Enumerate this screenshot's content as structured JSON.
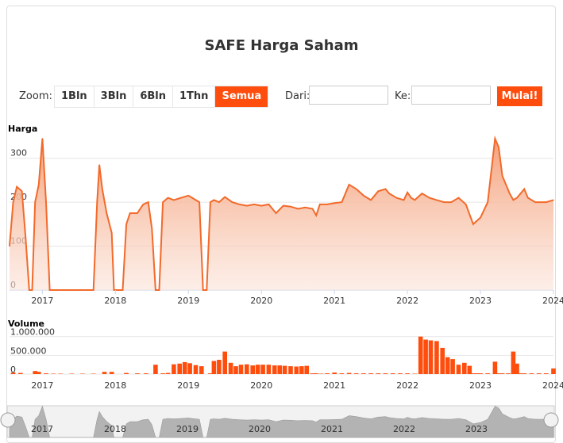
{
  "title": "SAFE Harga Saham",
  "zoom": {
    "label": "Zoom:",
    "buttons": [
      "1Bln",
      "3Bln",
      "6Bln",
      "1Thn",
      "Semua"
    ],
    "active": "Semua"
  },
  "range": {
    "from_label": "Dari:",
    "from_value": "",
    "to_label": "Ke:",
    "to_value": "",
    "submit_label": "Mulai!"
  },
  "colors": {
    "accent": "#ff4d0d",
    "line": "#f26a2b",
    "area_top": "#f5a07a",
    "volume": "#ff4d0d",
    "grid": "#e6e6e6"
  },
  "chart_data": [
    {
      "type": "area",
      "ylabel": "Harga",
      "ylim": [
        0,
        350
      ],
      "yticks": [
        0,
        100,
        200,
        300
      ],
      "xticks": [
        "2017",
        "2018",
        "2019",
        "2020",
        "2021",
        "2022",
        "2023",
        "2024"
      ],
      "x": [
        2016.55,
        2016.6,
        2016.65,
        2016.72,
        2016.77,
        2016.82,
        2016.86,
        2016.9,
        2016.95,
        2017.0,
        2017.05,
        2017.1,
        2017.14,
        2017.3,
        2017.6,
        2017.7,
        2017.75,
        2017.78,
        2017.82,
        2017.88,
        2017.95,
        2017.98,
        2018.02,
        2018.1,
        2018.15,
        2018.2,
        2018.3,
        2018.38,
        2018.45,
        2018.5,
        2018.55,
        2018.6,
        2018.65,
        2018.72,
        2018.8,
        2018.9,
        2019.0,
        2019.05,
        2019.15,
        2019.2,
        2019.25,
        2019.3,
        2019.35,
        2019.42,
        2019.5,
        2019.6,
        2019.7,
        2019.8,
        2019.9,
        2020.0,
        2020.1,
        2020.2,
        2020.3,
        2020.4,
        2020.5,
        2020.6,
        2020.7,
        2020.75,
        2020.8,
        2020.9,
        2021.0,
        2021.1,
        2021.2,
        2021.25,
        2021.3,
        2021.4,
        2021.5,
        2021.6,
        2021.7,
        2021.75,
        2021.85,
        2021.95,
        2022.0,
        2022.05,
        2022.1,
        2022.2,
        2022.3,
        2022.4,
        2022.5,
        2022.55,
        2022.6,
        2022.7,
        2022.8,
        2022.9,
        2023.0,
        2023.1,
        2023.2,
        2023.25,
        2023.3,
        2023.35,
        2023.4,
        2023.45,
        2023.5,
        2023.55,
        2023.6,
        2023.65,
        2023.7,
        2023.75,
        2023.8,
        2023.85,
        2023.9,
        2024.0
      ],
      "values": [
        100,
        200,
        235,
        225,
        120,
        0,
        0,
        200,
        240,
        345,
        200,
        0,
        0,
        0,
        0,
        0,
        200,
        285,
        230,
        175,
        130,
        0,
        0,
        0,
        150,
        175,
        175,
        195,
        200,
        140,
        0,
        0,
        200,
        210,
        205,
        210,
        215,
        210,
        200,
        0,
        0,
        200,
        205,
        200,
        212,
        200,
        195,
        192,
        195,
        192,
        195,
        175,
        192,
        190,
        185,
        188,
        185,
        170,
        195,
        195,
        198,
        200,
        240,
        235,
        230,
        215,
        205,
        225,
        230,
        220,
        210,
        205,
        222,
        210,
        205,
        220,
        210,
        205,
        200,
        200,
        200,
        210,
        195,
        150,
        165,
        200,
        345,
        325,
        260,
        240,
        220,
        205,
        210,
        220,
        230,
        210,
        205,
        200,
        200,
        200,
        200,
        205
      ]
    },
    {
      "type": "bar",
      "ylabel": "Volume",
      "ylim": [
        0,
        1100000
      ],
      "yticks": [
        "0",
        "500.000",
        "1.000.000"
      ],
      "xticks": [
        "2017",
        "2018",
        "2019",
        "2020",
        "2021",
        "2022",
        "2023",
        "2024"
      ],
      "x": [
        2016.6,
        2016.7,
        2016.9,
        2016.95,
        2017.05,
        2017.15,
        2017.25,
        2017.4,
        2017.55,
        2017.7,
        2017.85,
        2017.95,
        2018.15,
        2018.3,
        2018.42,
        2018.55,
        2018.65,
        2018.72,
        2018.8,
        2018.88,
        2018.95,
        2019.02,
        2019.1,
        2019.18,
        2019.3,
        2019.35,
        2019.42,
        2019.5,
        2019.58,
        2019.65,
        2019.72,
        2019.8,
        2019.88,
        2019.95,
        2020.02,
        2020.1,
        2020.18,
        2020.25,
        2020.32,
        2020.4,
        2020.48,
        2020.55,
        2020.62,
        2020.7,
        2020.75,
        2020.82,
        2020.9,
        2021.0,
        2021.1,
        2021.2,
        2021.3,
        2021.4,
        2021.5,
        2021.6,
        2021.7,
        2021.8,
        2021.9,
        2022.0,
        2022.1,
        2022.18,
        2022.25,
        2022.32,
        2022.4,
        2022.48,
        2022.55,
        2022.62,
        2022.7,
        2022.78,
        2022.85,
        2022.9,
        2022.95,
        2023.0,
        2023.1,
        2023.2,
        2023.25,
        2023.3,
        2023.38,
        2023.45,
        2023.5,
        2023.55,
        2023.6,
        2023.7,
        2023.8,
        2023.9,
        2024.0
      ],
      "values": [
        40000,
        30000,
        80000,
        60000,
        20000,
        10000,
        10000,
        10000,
        10000,
        10000,
        60000,
        60000,
        30000,
        20000,
        20000,
        250000,
        20000,
        30000,
        260000,
        280000,
        320000,
        290000,
        240000,
        210000,
        20000,
        350000,
        380000,
        600000,
        300000,
        210000,
        250000,
        260000,
        230000,
        250000,
        250000,
        250000,
        230000,
        230000,
        220000,
        210000,
        200000,
        210000,
        220000,
        20000,
        20000,
        10000,
        20000,
        40000,
        20000,
        30000,
        20000,
        20000,
        20000,
        20000,
        20000,
        20000,
        20000,
        20000,
        10000,
        1000000,
        920000,
        900000,
        880000,
        700000,
        450000,
        400000,
        250000,
        300000,
        220000,
        20000,
        20000,
        20000,
        20000,
        330000,
        20000,
        20000,
        20000,
        600000,
        280000,
        20000,
        20000,
        20000,
        20000,
        20000,
        150000
      ]
    }
  ],
  "navigator": {
    "labels": [
      "2017",
      "2018",
      "2019",
      "2020",
      "2021",
      "2022",
      "2023"
    ]
  }
}
